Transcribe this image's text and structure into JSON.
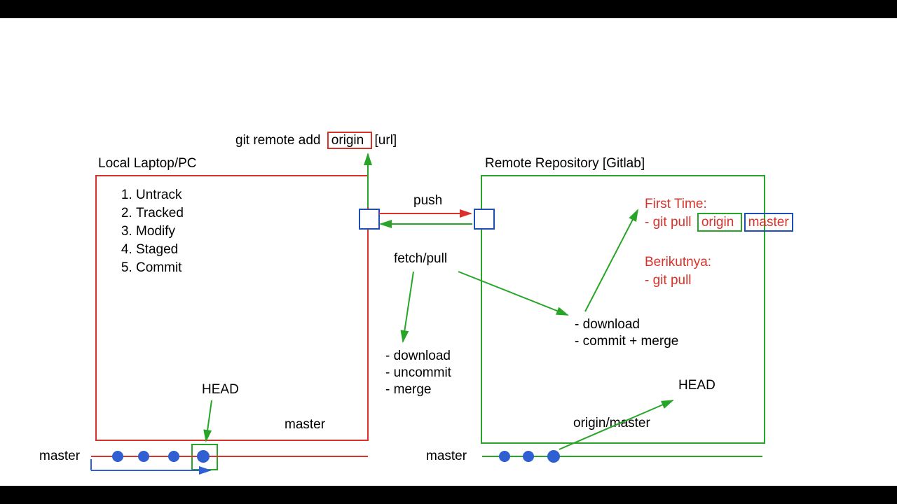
{
  "top_command": {
    "prefix": "git remote add",
    "boxed": "origin",
    "suffix": "[url]"
  },
  "labels": {
    "local_title": "Local Laptop/PC",
    "remote_title": "Remote Repository [Gitlab]",
    "push": "push",
    "fetch_pull": "fetch/pull",
    "head_left": "HEAD",
    "head_right": "HEAD",
    "master_inside_left": "master",
    "origin_master": "origin/master",
    "master_left": "master",
    "master_right": "master"
  },
  "file_states": [
    "Untrack",
    "Tracked",
    "Modify",
    "Staged",
    "Commit"
  ],
  "fetch_steps": [
    "download",
    "uncommit",
    "merge"
  ],
  "remote_steps": [
    "download",
    "commit + merge"
  ],
  "first_time": {
    "heading": "First Time:",
    "prefix": "- git pull",
    "box1": "origin",
    "box2": "master"
  },
  "next_time": {
    "heading": "Berikutnya:",
    "line": "- git pull"
  }
}
